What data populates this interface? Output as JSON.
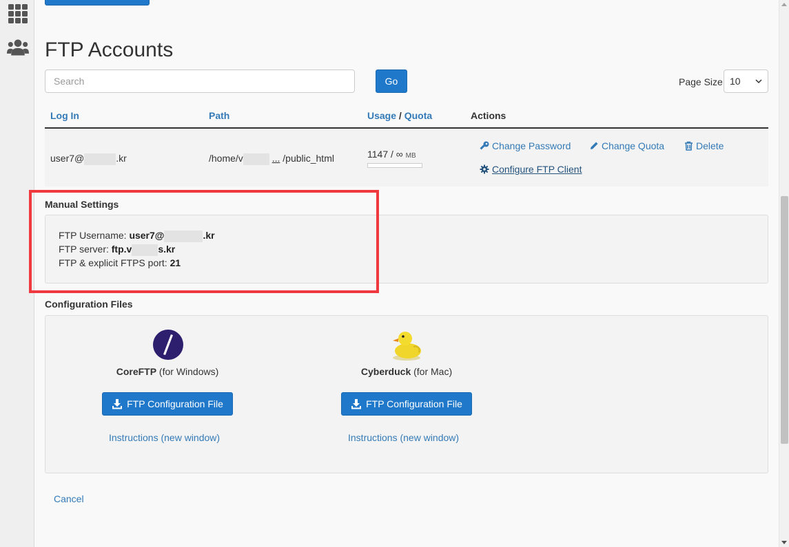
{
  "sidebar": {
    "icons": [
      "apps-grid-icon",
      "users-icon"
    ]
  },
  "page": {
    "title": "FTP Accounts"
  },
  "search": {
    "placeholder": "Search",
    "go_label": "Go"
  },
  "page_size": {
    "label": "Page Size",
    "value": "10"
  },
  "table": {
    "headers": {
      "login": "Log In",
      "path": "Path",
      "usage": "Usage",
      "slash": " / ",
      "quota": "Quota",
      "actions": "Actions"
    },
    "row": {
      "login_prefix": "user7@",
      "login_suffix": ".kr",
      "path_prefix": "/home/v",
      "path_ellipsis": "...",
      "path_suffix": "/public_html",
      "usage": "1147 / ∞",
      "usage_unit": "MB",
      "actions": {
        "change_password": "Change Password",
        "change_quota": "Change Quota",
        "delete": "Delete",
        "configure": "Configure FTP Client"
      }
    }
  },
  "manual": {
    "title": "Manual Settings",
    "username_label": "FTP Username: ",
    "username_prefix": "user7@",
    "username_suffix": ".kr",
    "server_label": "FTP server: ",
    "server_prefix": "ftp.v",
    "server_suffix": "s.kr",
    "port_label": "FTP & explicit FTPS port:  ",
    "port_value": "21"
  },
  "config": {
    "title": "Configuration Files",
    "clients": [
      {
        "name": "CoreFTP",
        "platform": " (for Windows)",
        "button": "FTP Configuration File",
        "instructions": "Instructions (new window)"
      },
      {
        "name": "Cyberduck",
        "platform": " (for Mac)",
        "button": "FTP Configuration File",
        "instructions": "Instructions (new window)"
      }
    ]
  },
  "cancel_label": "Cancel",
  "colors": {
    "primary": "#1f78c9",
    "link": "#337ab7",
    "highlight": "#f0393f"
  }
}
